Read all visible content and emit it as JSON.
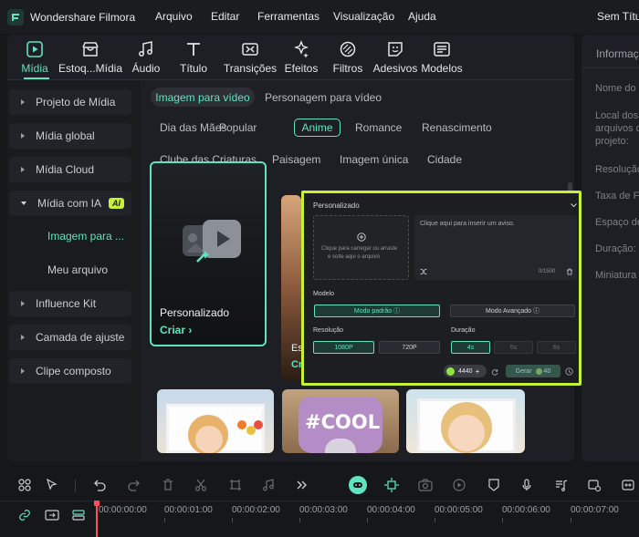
{
  "app": {
    "title": "Wondershare Filmora"
  },
  "menu": {
    "items": [
      "Arquivo",
      "Editar",
      "Ferramentas",
      "Visualização",
      "Ajuda"
    ],
    "right": "Sem Títu"
  },
  "tabs": [
    "Mídia",
    "Estoq...Mídia",
    "Áudio",
    "Título",
    "Transições",
    "Efeitos",
    "Filtros",
    "Adesivos",
    "Modelos"
  ],
  "sidebar": {
    "items": [
      "Projeto de Mídia",
      "Mídia global",
      "Mídia Cloud",
      "Mídia com IA",
      "Influence Kit",
      "Camada de ajuste",
      "Clipe composto"
    ],
    "ai_badge": "AI",
    "sub_items": [
      "Imagem para ...",
      "Meu arquivo"
    ]
  },
  "content": {
    "modes": [
      "Imagem para vídeo",
      "Personagem para vídeo"
    ],
    "categories_row1": [
      "Dia das Mães",
      "Popular",
      "Anime",
      "Romance",
      "Renascimento"
    ],
    "categories_row2": [
      "Clube das Criaturas",
      "Paisagem",
      "Imagem única",
      "Cidade"
    ],
    "active_category": "Anime",
    "card_main": {
      "title": "Personalizado",
      "cta": "Criar ›"
    },
    "card_partial_title": "Es",
    "card_partial_cta": "Cr",
    "thumb_text": "#COOL"
  },
  "popup": {
    "title": "Personalizado",
    "upload_text_1": "Clique para carregar ou arraste",
    "upload_text_2": "e solte aqui o arquivo",
    "prompt_placeholder": "Clique aqui para inserir um aviso.",
    "char_count": "0/1500",
    "model_label": "Modelo",
    "model_options": [
      "Modo padrão ⓘ",
      "Modo Avançado ⓘ"
    ],
    "resolution_label": "Resolução",
    "resolution_options": [
      "1080P",
      "720P"
    ],
    "duration_label": "Duração",
    "duration_options": [
      "4s",
      "5s",
      "6s"
    ],
    "credits": "4440",
    "generate_label": "Gerar",
    "generate_cost": "40"
  },
  "right_panel": {
    "title": "Informaç",
    "rows": [
      "Nome do",
      "Local dos",
      "arquivos d",
      "projeto:",
      "Resolução",
      "Taxa de Fr",
      "Espaço de",
      "Duração:",
      "Miniatura"
    ]
  },
  "timeline": {
    "times": [
      "00:00:00:00",
      "00:00:01:00",
      "00:00:02:00",
      "00:00:03:00",
      "00:00:04:00",
      "00:00:05:00",
      "00:00:06:00",
      "00:00:07:00"
    ]
  },
  "colors": {
    "accent": "#5fe3c0",
    "highlight": "#c6f13a",
    "playhead": "#ff4f5e"
  }
}
